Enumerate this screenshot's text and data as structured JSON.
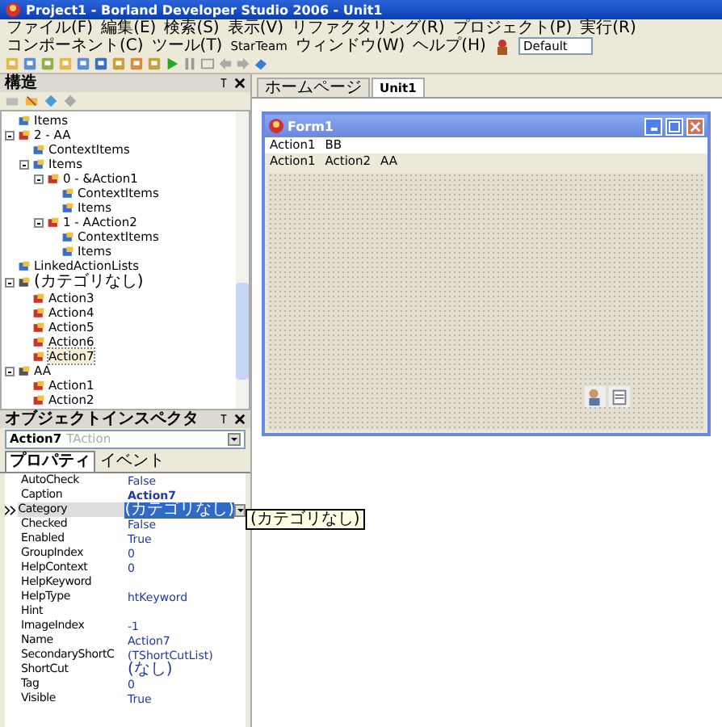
{
  "window": {
    "title": "Project1 - Borland Developer Studio 2006 - Unit1"
  },
  "menu": [
    "ファイル(F)",
    "編集(E)",
    "検索(S)",
    "表示(V)",
    "リファクタリング(R)",
    "プロジェクト(P)",
    "実行(R)",
    "コンポーネント(C)",
    "ツール(T)",
    "StarTeam",
    "ウィンドウ(W)",
    "ヘルプ(H)"
  ],
  "layout_field": {
    "value": "Default"
  },
  "structure": {
    "title": "構造",
    "nodes": [
      {
        "label": "Items",
        "kind": "collection"
      },
      {
        "label": "2 - AA",
        "kind": "action",
        "expanded": true,
        "children": [
          {
            "label": "ContextItems",
            "kind": "collection"
          },
          {
            "label": "Items",
            "kind": "collection",
            "expanded": true,
            "children": [
              {
                "label": "0 - &Action1",
                "kind": "action",
                "expanded": true,
                "children": [
                  {
                    "label": "ContextItems",
                    "kind": "collection"
                  },
                  {
                    "label": "Items",
                    "kind": "collection"
                  }
                ]
              },
              {
                "label": "1 - AAction2",
                "kind": "action",
                "expanded": true,
                "children": [
                  {
                    "label": "ContextItems",
                    "kind": "collection"
                  },
                  {
                    "label": "Items",
                    "kind": "collection"
                  }
                ]
              }
            ]
          }
        ]
      },
      {
        "label": "LinkedActionLists",
        "kind": "collection"
      },
      {
        "label": "(カテゴリなし)",
        "kind": "category",
        "expanded": true,
        "children": [
          {
            "label": "Action3",
            "kind": "item",
            "selected": false
          },
          {
            "label": "Action4",
            "kind": "item",
            "selected": false
          },
          {
            "label": "Action5",
            "kind": "item",
            "selected": false
          },
          {
            "label": "Action6",
            "kind": "item",
            "selected": false
          },
          {
            "label": "Action7",
            "kind": "item",
            "selected": true
          }
        ]
      },
      {
        "label": "AA",
        "kind": "category",
        "expanded": true,
        "children": [
          {
            "label": "Action1",
            "kind": "item",
            "selected": false
          },
          {
            "label": "Action2",
            "kind": "item",
            "selected": false
          }
        ]
      }
    ]
  },
  "inspector": {
    "title": "オブジェクトインスペクタ",
    "object": "Action7",
    "object_type": "TAction",
    "tabs": [
      {
        "label": "プロパティ",
        "selected": true
      },
      {
        "label": "イベント",
        "selected": false
      }
    ],
    "properties": [
      {
        "name": "AutoCheck",
        "value": "False",
        "modified": false,
        "selected": false
      },
      {
        "name": "Caption",
        "value": "Action7",
        "modified": true,
        "selected": false
      },
      {
        "name": "Category",
        "value": "(カテゴリなし)",
        "modified": false,
        "selected": true
      },
      {
        "name": "Checked",
        "value": "False",
        "modified": false,
        "selected": false
      },
      {
        "name": "Enabled",
        "value": "True",
        "modified": false,
        "selected": false
      },
      {
        "name": "GroupIndex",
        "value": "0",
        "modified": false,
        "selected": false
      },
      {
        "name": "HelpContext",
        "value": "0",
        "modified": false,
        "selected": false
      },
      {
        "name": "HelpKeyword",
        "selected": false
      },
      {
        "name": "HelpType",
        "value": "htKeyword",
        "modified": false,
        "selected": false
      },
      {
        "name": "Hint",
        "selected": false
      },
      {
        "name": "ImageIndex",
        "value": "-1",
        "modified": false,
        "selected": false
      },
      {
        "name": "Name",
        "value": "Action7",
        "modified": false,
        "selected": false
      },
      {
        "name": "SecondaryShortC",
        "value": "(TShortCutList)",
        "modified": false,
        "selected": false
      },
      {
        "name": "ShortCut",
        "value": "(なし)",
        "modified": false,
        "selected": false
      },
      {
        "name": "Tag",
        "value": "0",
        "modified": false,
        "selected": false
      },
      {
        "name": "Visible",
        "value": "True",
        "modified": false,
        "selected": false
      }
    ],
    "tooltip": "(カテゴリなし)"
  },
  "editor_tabs": [
    {
      "label": "ホームページ",
      "selected": false
    },
    {
      "label": "Unit1",
      "selected": true
    }
  ],
  "form": {
    "title": "Form1",
    "menu": [
      "Action1",
      "BB"
    ],
    "toolbar": [
      "Action1",
      "Action2",
      "AA"
    ]
  }
}
